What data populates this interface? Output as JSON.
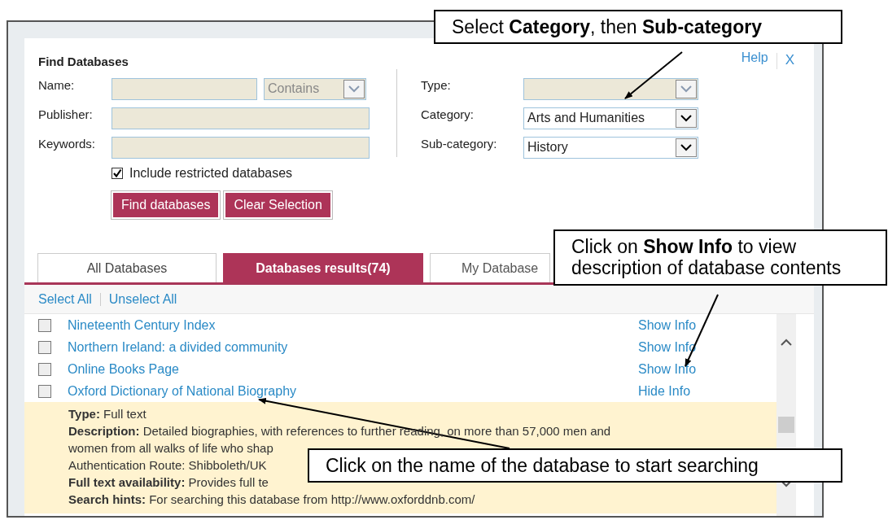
{
  "panel": {
    "title": "Find Databases",
    "help_link": "Help",
    "close_symbol": "X"
  },
  "form_left": [
    {
      "label": "Name:",
      "kind": "text_with_select",
      "select": {
        "value": "Contains",
        "disabled": true
      }
    },
    {
      "label": "Publisher:",
      "kind": "text"
    },
    {
      "label": "Keywords:",
      "kind": "text"
    }
  ],
  "form_right": [
    {
      "label": "Type:",
      "disabled": true
    },
    {
      "label": "Category:",
      "value": "Arts and Humanities",
      "disabled": false
    },
    {
      "label": "Sub-category:",
      "value": "History",
      "disabled": false
    }
  ],
  "include_restricted": {
    "label": "Include restricted databases",
    "checked": true
  },
  "buttons": [
    "Find databases",
    "Clear Selection"
  ],
  "tabs": [
    {
      "label": "All Databases",
      "selected": false
    },
    {
      "label": "Databases results(74)",
      "selected": true
    },
    {
      "label": "My Database",
      "selected": false
    }
  ],
  "selection_links": [
    "Select All",
    "Unselect All"
  ],
  "results": [
    {
      "name": "Nineteenth Century Index",
      "info_link": "Show Info",
      "checked": false
    },
    {
      "name": "Northern Ireland: a divided community",
      "info_link": "Show Info",
      "checked": false
    },
    {
      "name": "Online Books Page",
      "info_link": "Show Info",
      "checked": false
    },
    {
      "name": "Oxford Dictionary of National Biography",
      "info_link": "Hide Info",
      "checked": false,
      "expanded": true,
      "info": [
        {
          "label": "Type:",
          "value": "Full text"
        },
        {
          "label": "Description:",
          "value": "Detailed biographies, with references to further reading, on more than 57,000 men and"
        },
        {
          "value": "women from all walks of life who shap"
        },
        {
          "value": "Authentication Route: Shibboleth/UK"
        },
        {
          "label": "Full text availability:",
          "value": "Provides full te"
        },
        {
          "label": "Search hints:",
          "value": "For searching this database from http://www.oxforddnb.com/"
        }
      ]
    }
  ],
  "callouts": [
    {
      "text": "Select **Category**, then **Sub-category**"
    },
    {
      "text": "Click on **Show Info** to view description of database contents"
    },
    {
      "text": "Click on the name of the database to start searching"
    }
  ]
}
